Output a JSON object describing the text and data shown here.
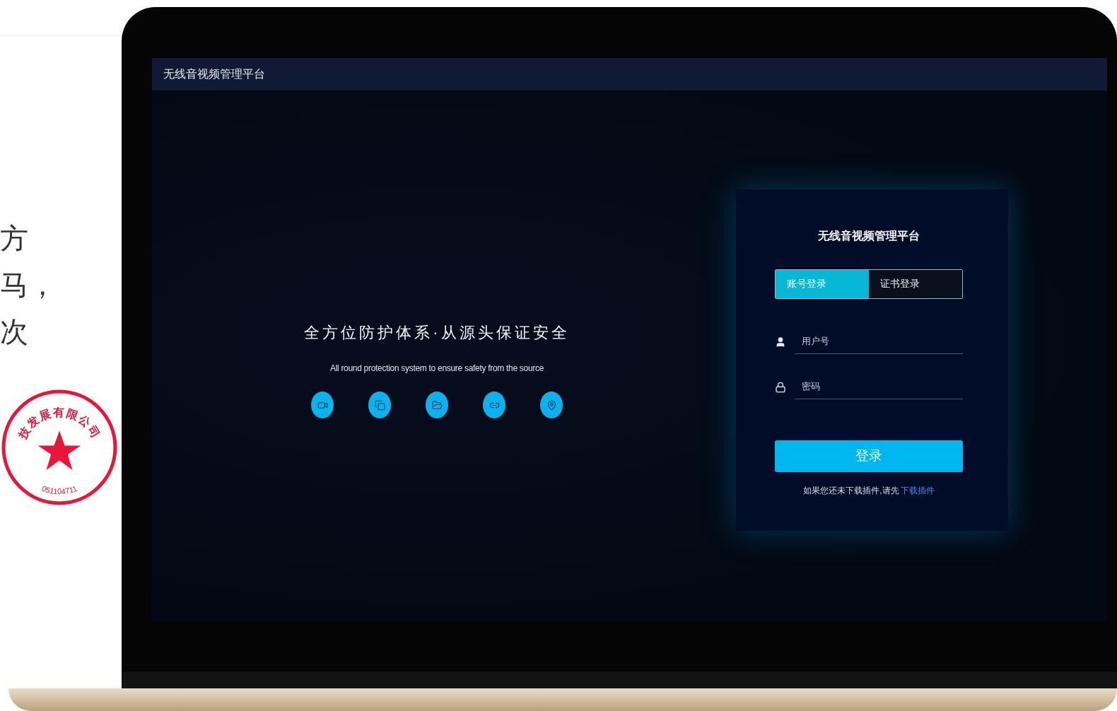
{
  "page_fragments": [
    "方",
    "马，",
    "次"
  ],
  "stamp": {
    "name": "技发展有限公司",
    "number": "051104711"
  },
  "app": {
    "title": "无线音视频管理平台",
    "slogan": "全方位防护体系·从源头保证安全",
    "slogan_en": "All round protection system to ensure safety from the source",
    "login": {
      "title": "无线音视频管理平台",
      "tabs": [
        {
          "label": "账号登录",
          "selected": true
        },
        {
          "label": "证书登录",
          "selected": false
        }
      ],
      "fields": [
        {
          "kind": "user",
          "placeholder": "用户号"
        },
        {
          "kind": "password",
          "placeholder": "密码"
        }
      ],
      "submit": "登录",
      "hint": "如果您还未下载插件,请先",
      "link": "下载插件"
    }
  }
}
